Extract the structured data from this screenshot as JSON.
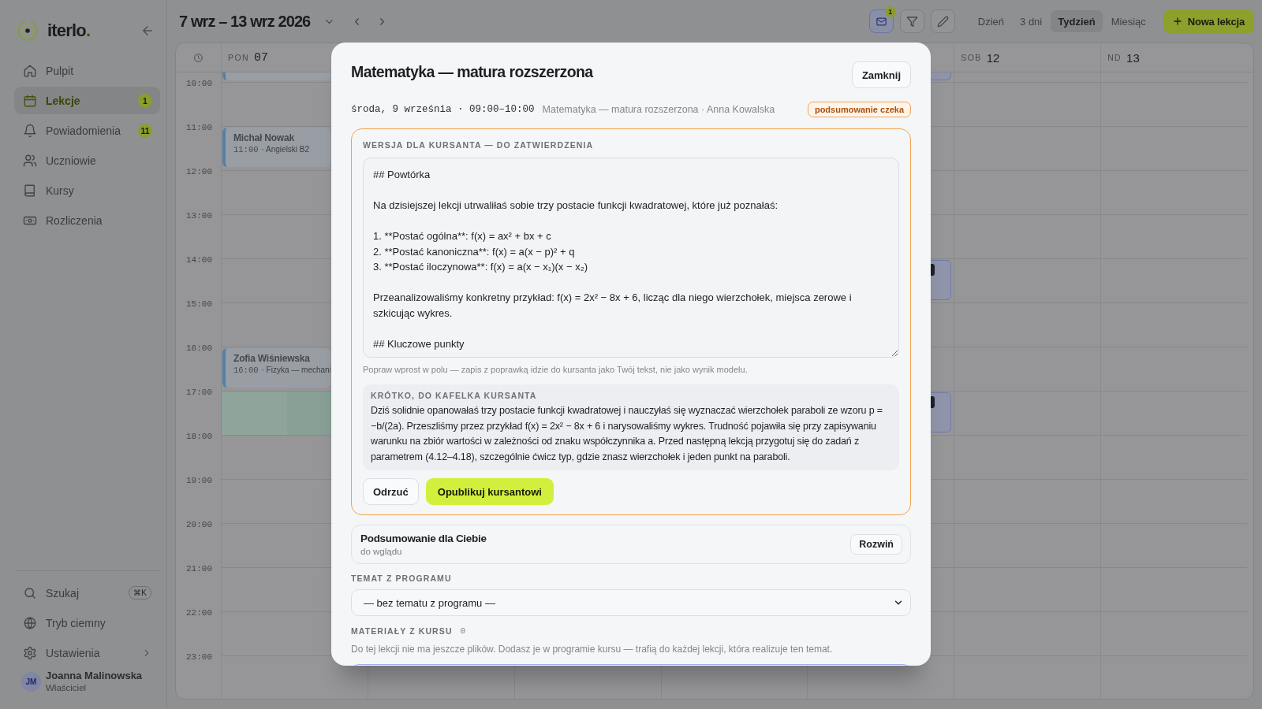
{
  "sidebar": {
    "logo": {
      "text": "iterlo",
      "accent": "."
    },
    "nav": [
      {
        "label": "Pulpit",
        "selected": false
      },
      {
        "label": "Lekcje",
        "selected": true,
        "badge": "1"
      },
      {
        "label": "Powiadomienia",
        "selected": false,
        "badge": "11"
      },
      {
        "label": "Uczniowie",
        "selected": false
      },
      {
        "label": "Kursy",
        "selected": false
      },
      {
        "label": "Rozliczenia",
        "selected": false
      }
    ],
    "footer": [
      {
        "label": "Szukaj",
        "shortcut": "⌘K"
      },
      {
        "label": "Tryb ciemny"
      },
      {
        "label": "Ustawienia"
      }
    ],
    "user": {
      "initials": "JM",
      "name": "Joanna Malinowska",
      "role": "Właściciel"
    }
  },
  "toolbar": {
    "range": "7 wrz – 13 wrz 2026",
    "tools": [
      {
        "active": true,
        "badge": "1"
      },
      {
        "active": false
      },
      {
        "active": false
      }
    ],
    "views": [
      {
        "label": "Dzień",
        "selected": false
      },
      {
        "label": "3 dni",
        "selected": false
      },
      {
        "label": "Tydzień",
        "selected": true
      },
      {
        "label": "Miesiąc",
        "selected": false
      }
    ],
    "new_button": "Nowa lekcja"
  },
  "calendar": {
    "days": [
      {
        "weekday": "PON",
        "date": "07",
        "kind": "weekday"
      },
      {
        "weekday": "SOB",
        "date": "12",
        "kind": "weekend"
      },
      {
        "weekday": "ND",
        "date": "13",
        "kind": "weekend"
      }
    ],
    "hours": [
      "10:00",
      "11:00",
      "12:00",
      "13:00",
      "14:00",
      "15:00",
      "16:00",
      "17:00",
      "18:00",
      "19:00",
      "20:00",
      "21:00",
      "22:00",
      "23:00"
    ],
    "events": [
      {
        "name": "Michał Nowak",
        "time": "11:00",
        "subject": "· Angielski B2"
      },
      {
        "name": "Zofia Wiśniewska",
        "time": "16:00",
        "subject": "· Fizyka — mechani"
      }
    ]
  },
  "dialog": {
    "title": "Matematyka — matura rozszerzona",
    "close_button": "Zamknij",
    "datetime": "środa, 9 września · 09:00–10:00",
    "info": "Matematyka — matura rozszerzona · Anna Kowalska",
    "status_tag": "podsumowanie czeka",
    "review": {
      "label": "WERSJA DLA KURSANTA — DO ZATWIERDZENIA",
      "editor_value": "## Powtórka\n\nNa dzisiejszej lekcji utrwaliłaś sobie trzy postacie funkcji kwadratowej, które już poznałaś:\n\n1. **Postać ogólna**: f(x) = ax² + bx + c\n2. **Postać kanoniczna**: f(x) = a(x − p)² + q\n3. **Postać iloczynowa**: f(x) = a(x − x₁)(x − x₂)\n\nPrzeanalizowaliśmy konkretny przykład: f(x) = 2x² − 8x + 6, licząc dla niego wierzchołek, miejsca zerowe i szkicując wykres.\n\n## Kluczowe punkty",
      "hint": "Popraw wprost w polu — zapis z poprawką idzie do kursanta jako Twój tekst, nie jako wynik modelu.",
      "short_label": "KRÓTKO, DO KAFELKA KURSANTA",
      "short_text": "Dziś solidnie opanowałaś trzy postacie funkcji kwadratowej i nauczyłaś się wyznaczać wierzchołek paraboli ze wzoru p = −b/(2a). Przeszliśmy przez przykład f(x) = 2x² − 8x + 6 i narysowaliśmy wykres. Trudność pojawiła się przy zapisywaniu warunku na zbiór wartości w zależności od znaku współczynnika a. Przed następną lekcją przygotuj się do zadań z parametrem (4.12–4.18), szczególnie ćwicz typ, gdzie znasz wierzchołek i jeden punkt na paraboli.",
      "reject_button": "Odrzuć",
      "publish_button": "Opublikuj kursantowi"
    },
    "own_summary": {
      "title": "Podsumowanie dla Ciebie",
      "subtitle": "do wglądu",
      "button": "Rozwiń"
    },
    "topic": {
      "label": "TEMAT Z PROGRAMU",
      "value": "— bez tematu z programu —"
    },
    "materials": {
      "label": "MATERIAŁY Z KURSU",
      "count": "0",
      "hint": "Do tej lekcji nie ma jeszcze plików. Dodasz je w programie kursu — trafią do każdej lekcji, która realizuje ten temat."
    }
  }
}
